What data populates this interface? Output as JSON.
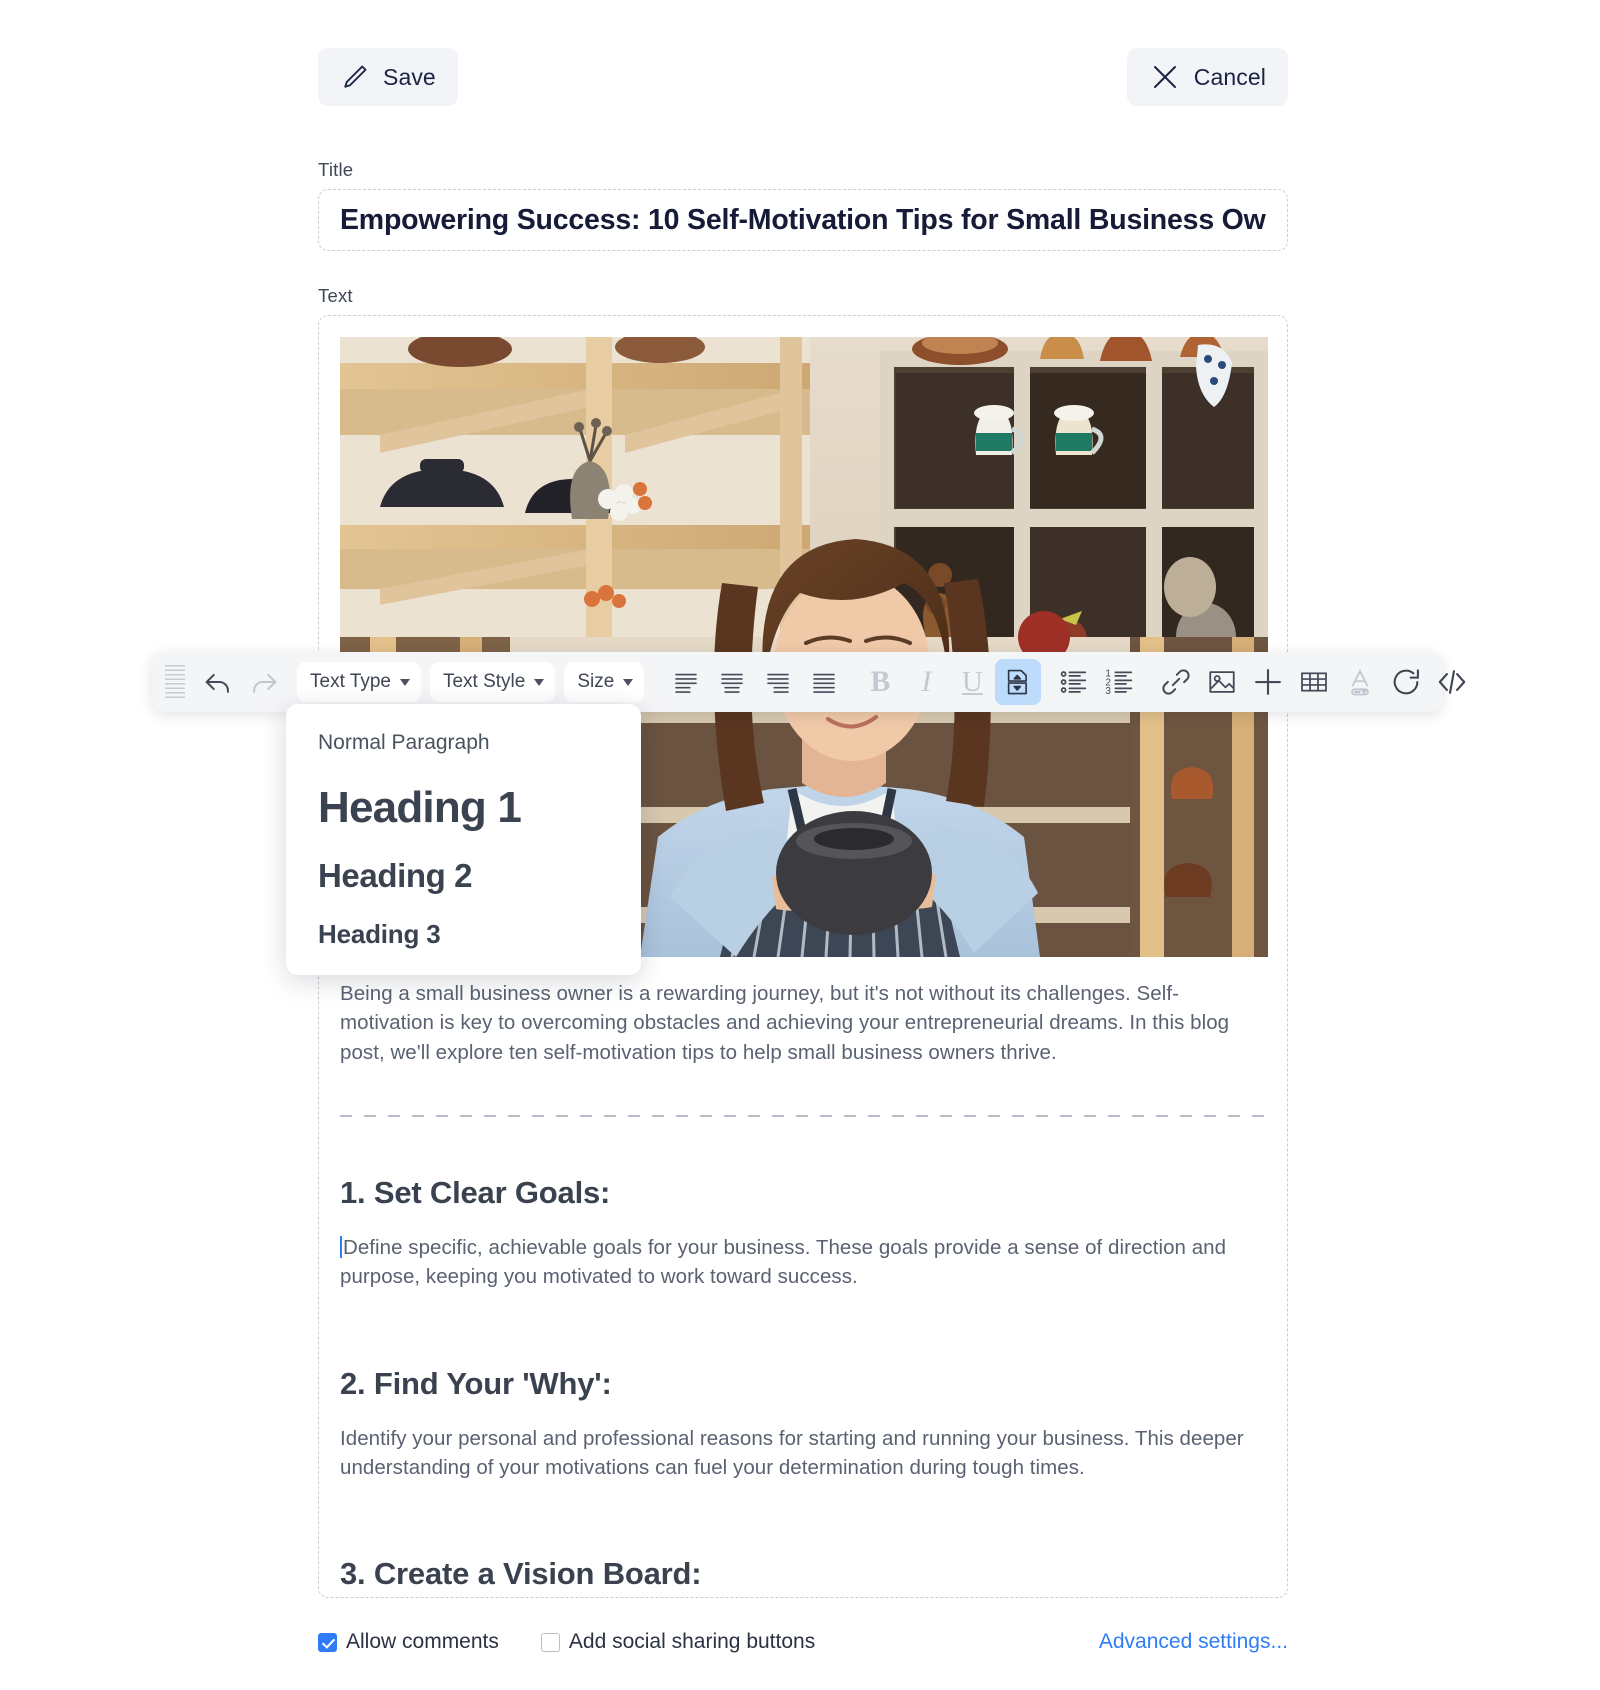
{
  "toolbar_actions": {
    "save_label": "Save",
    "save_icon": "pencil-icon",
    "cancel_label": "Cancel",
    "cancel_icon": "close-x-icon"
  },
  "form": {
    "title_label": "Title",
    "title_value": "Empowering Success: 10 Self-Motivation Tips for Small Business Ow",
    "text_label": "Text"
  },
  "format_toolbar": {
    "grip": "drag-handle",
    "undo_icon": "undo-arrow-icon",
    "redo_icon": "redo-arrow-icon",
    "text_type_label": "Text Type",
    "text_style_label": "Text Style",
    "size_label": "Size",
    "align_left_icon": "align-left-icon",
    "align_center_icon": "align-center-icon",
    "align_right_icon": "align-right-icon",
    "align_justify_icon": "align-justify-icon",
    "bold_label": "B",
    "italic_label": "I",
    "underline_label": "U",
    "page_break_icon": "page-break-icon",
    "bullet_list_icon": "bulleted-list-icon",
    "numbered_list_icon": "numbered-list-icon",
    "link_icon": "link-icon",
    "image_icon": "image-icon",
    "add_icon": "plus-icon",
    "table_icon": "table-icon",
    "font_color_icon": "font-color-icon",
    "refresh_icon": "refresh-icon",
    "source_code_icon": "source-code-icon"
  },
  "text_type_menu": {
    "items": [
      {
        "label": "Normal Paragraph"
      },
      {
        "label": "Heading 1"
      },
      {
        "label": "Heading 2"
      },
      {
        "label": "Heading 3"
      }
    ]
  },
  "document": {
    "image_alt": "woman-in-pottery-shop-photo",
    "intro": "Being a small business owner is a rewarding journey, but it's not without its challenges. Self-motivation is key to overcoming obstacles and achieving your entrepreneurial dreams. In this blog post, we'll explore ten self-motivation tips to help small business owners thrive.",
    "sections": [
      {
        "heading": "1. Set Clear Goals:",
        "body": "Define specific, achievable goals for your business. These goals provide a sense of direction and purpose, keeping you motivated to work toward success."
      },
      {
        "heading": "2. Find Your 'Why':",
        "body": "Identify your personal and professional reasons for starting and running your business. This deeper understanding of your motivations can fuel your determination during tough times."
      },
      {
        "heading": "3. Create a Vision Board:",
        "body": ""
      }
    ]
  },
  "footer": {
    "allow_comments_label": "Allow comments",
    "allow_comments_checked": true,
    "social_sharing_label": "Add social sharing buttons",
    "social_sharing_checked": false,
    "advanced_settings_label": "Advanced settings..."
  },
  "colors": {
    "accent_blue": "#2f7df6",
    "toolbar_bg": "#f4f5f7",
    "button_bg": "#f2f4f8",
    "active_highlight": "#bddcfb"
  }
}
